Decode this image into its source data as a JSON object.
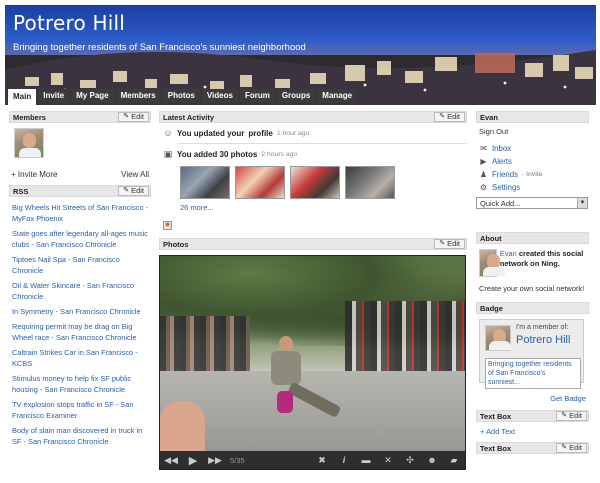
{
  "header": {
    "title": "Potrero Hill",
    "tagline": "Bringing together residents of San Francisco's sunniest neighborhood"
  },
  "tabs": [
    {
      "label": "Main",
      "active": true
    },
    {
      "label": "Invite"
    },
    {
      "label": "My Page"
    },
    {
      "label": "Members"
    },
    {
      "label": "Photos"
    },
    {
      "label": "Videos"
    },
    {
      "label": "Forum"
    },
    {
      "label": "Groups"
    },
    {
      "label": "Manage"
    }
  ],
  "members": {
    "title": "Members",
    "edit": "Edit",
    "invite_more": "+ Invite More",
    "view_all": "View All"
  },
  "rss": {
    "title": "RSS",
    "edit": "Edit",
    "items": [
      "Big Wheels Hit Streets of San Francisco - MyFox Phoenix",
      "State goes after legendary all-ages music clubs - San Francisco Chronicle",
      "Tiptoes Nail Spa - San Francisco Chronicle",
      "Oil & Water Skincare - San Francisco Chronicle",
      "In Symmetry - San Francisco Chronicle",
      "Requiring permit may be drag on Big Wheel race - San Francisco Chronicle",
      "Caltrain Strikes Car in San Francisco - KCBS",
      "Stimulus money to help fix SF public housing - San Francisco Chronicle",
      "TV explosion stops traffic in SF - San Francisco Examiner",
      "Body of slain man discovered in truck in SF - San Francisco Chronicle"
    ]
  },
  "activity": {
    "title": "Latest Activity",
    "edit": "Edit",
    "item1_prefix": "You updated your",
    "item1_link": "profile",
    "item1_time": "1 hour ago",
    "item2_text": "You added 30 photos",
    "item2_time": "2 hours ago",
    "more": "26 more..."
  },
  "photos": {
    "title": "Photos",
    "edit": "Edit",
    "counter": "5/35"
  },
  "user_panel": {
    "title": "Evan",
    "sign_out": "Sign Out",
    "inbox": "Inbox",
    "alerts": "Alerts",
    "friends": "Friends",
    "friends_invite": "- Invite",
    "settings": "Settings",
    "quick_add": "Quick Add..."
  },
  "about": {
    "title": "About",
    "creator_name": "Evan",
    "creator_text": "created this social network on Ning.",
    "create_own": "Create your own social network!"
  },
  "badge": {
    "title": "Badge",
    "member_of": "I'm a member of:",
    "name": "Potrero Hill",
    "tagline": "Bringing together residents of San Francisco's sunniest...",
    "get_badge": "Get Badge"
  },
  "textbox1": {
    "title": "Text Box",
    "edit": "Edit",
    "add_text": "+ Add Text"
  },
  "textbox2": {
    "title": "Text Box",
    "edit": "Edit"
  },
  "colors": {
    "link": "#2a5fa8",
    "tab_bg": "#3b3b3b",
    "module_head": "#e7e7e7"
  },
  "icons": [
    "pencil-icon",
    "person-icon",
    "photo-icon",
    "rss-icon",
    "inbox-icon",
    "alerts-icon",
    "friends-icon",
    "settings-icon",
    "prev-icon",
    "play-icon",
    "next-icon",
    "info-icon",
    "fullscreen-icon"
  ]
}
